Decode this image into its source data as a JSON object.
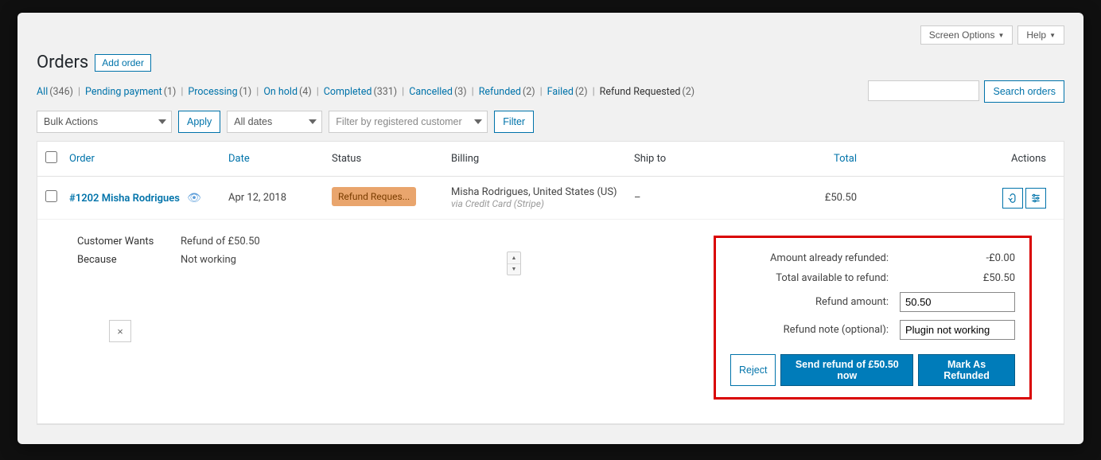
{
  "topbar": {
    "screen_options": "Screen Options",
    "help": "Help"
  },
  "heading": "Orders",
  "add_order": "Add order",
  "filters": {
    "all": {
      "label": "All",
      "count": "(346)"
    },
    "pending": {
      "label": "Pending payment",
      "count": "(1)"
    },
    "processing": {
      "label": "Processing",
      "count": "(1)"
    },
    "onhold": {
      "label": "On hold",
      "count": "(4)"
    },
    "completed": {
      "label": "Completed",
      "count": "(331)"
    },
    "cancelled": {
      "label": "Cancelled",
      "count": "(3)"
    },
    "refunded": {
      "label": "Refunded",
      "count": "(2)"
    },
    "failed": {
      "label": "Failed",
      "count": "(2)"
    },
    "refund_requested": {
      "label": "Refund Requested",
      "count": "(2)"
    }
  },
  "search_orders": "Search orders",
  "bulk_actions": "Bulk Actions",
  "apply": "Apply",
  "all_dates": "All dates",
  "filter_customer": "Filter by registered customer",
  "filter": "Filter",
  "columns": {
    "order": "Order",
    "date": "Date",
    "status": "Status",
    "billing": "Billing",
    "ship": "Ship to",
    "total": "Total",
    "actions": "Actions"
  },
  "row": {
    "order": "#1202 Misha Rodrigues",
    "date": "Apr 12, 2018",
    "status": "Refund Reques...",
    "billing_line": "Misha Rodrigues, United States (US)",
    "billing_sub": "via Credit Card (Stripe)",
    "ship": "–",
    "total": "£50.50"
  },
  "expanded": {
    "wants_label": "Customer Wants",
    "wants_value": "Refund of £50.50",
    "because_label": "Because",
    "because_value": "Not working",
    "close": "×"
  },
  "refund": {
    "already_label": "Amount already refunded:",
    "already_value": "-£0.00",
    "avail_label": "Total available to refund:",
    "avail_value": "£50.50",
    "amount_label": "Refund amount:",
    "amount_value": "50.50",
    "note_label": "Refund note (optional):",
    "note_value": "Plugin not working",
    "reject": "Reject",
    "send": "Send refund of £50.50 now",
    "mark": "Mark As Refunded"
  }
}
